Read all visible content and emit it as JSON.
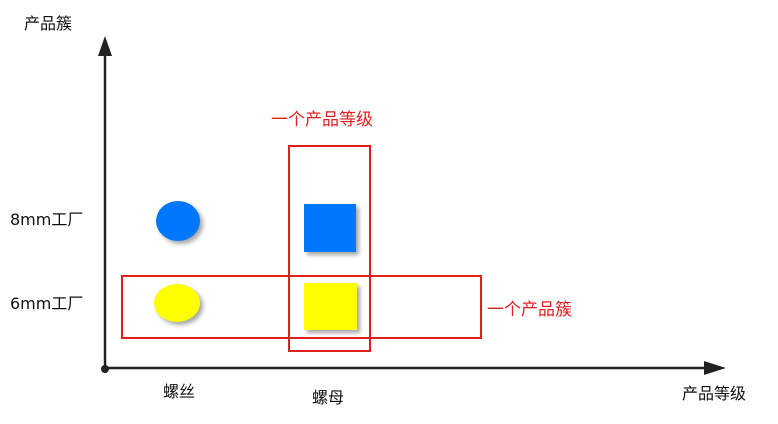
{
  "axes": {
    "y_title": "产品簇",
    "x_title": "产品等级"
  },
  "rows": [
    {
      "label": "8mm工厂",
      "color": "#0077ff"
    },
    {
      "label": "6mm工厂",
      "color": "#ffff00"
    }
  ],
  "columns": [
    {
      "label": "螺丝",
      "shape": "circle"
    },
    {
      "label": "螺母",
      "shape": "square"
    }
  ],
  "annotations": {
    "grade_box_label": "一个产品等级",
    "family_box_label": "一个产品簇"
  },
  "colors": {
    "highlight": "#e02020",
    "axis": "#222222"
  }
}
